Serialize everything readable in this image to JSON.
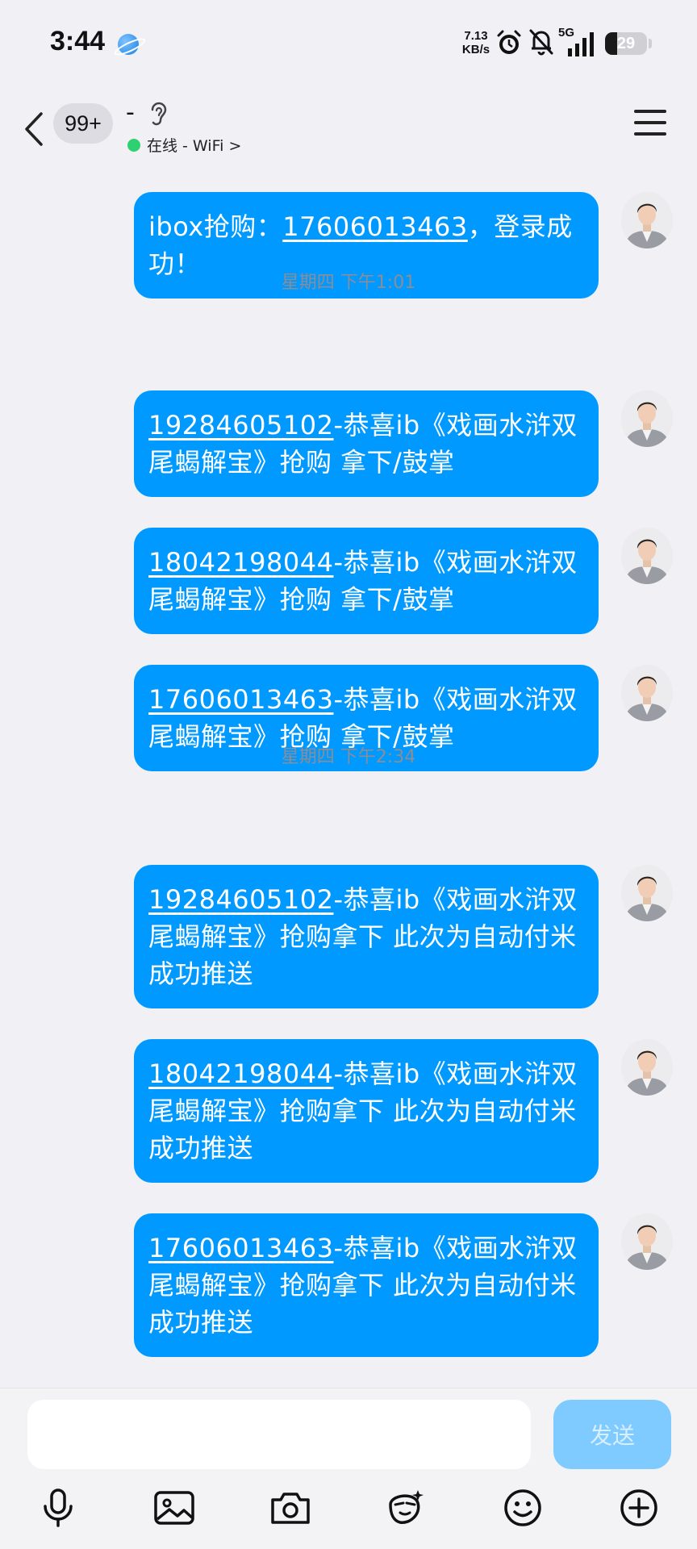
{
  "status_bar": {
    "time": "3:44",
    "net_speed_value": "7.13",
    "net_speed_unit": "KB/s",
    "network": "5G",
    "battery": "29",
    "battery_level": 0.29
  },
  "header": {
    "unread_count": "99+",
    "contact_name": "-",
    "status_text": "在线 - WiFi >",
    "status_color": "#2fd06f"
  },
  "messages": [
    {
      "type": "message",
      "phone": "",
      "text_before": "ibox抢购：",
      "phone_inline": "17606013463",
      "text": "，登录成功！"
    },
    {
      "type": "time",
      "text": "星期四 下午1:01"
    },
    {
      "type": "message",
      "phone": "19284605102",
      "text": "-恭喜ib《戏画水浒双尾蝎解宝》抢购 拿下/鼓掌"
    },
    {
      "type": "message",
      "phone": "18042198044",
      "text": "-恭喜ib《戏画水浒双尾蝎解宝》抢购 拿下/鼓掌"
    },
    {
      "type": "message",
      "phone": "17606013463",
      "text": "-恭喜ib《戏画水浒双尾蝎解宝》抢购 拿下/鼓掌"
    },
    {
      "type": "time",
      "text": "星期四 下午2:34"
    },
    {
      "type": "message",
      "phone": "19284605102",
      "text": "-恭喜ib《戏画水浒双尾蝎解宝》抢购拿下 此次为自动付米成功推送"
    },
    {
      "type": "message",
      "phone": "18042198044",
      "text": "-恭喜ib《戏画水浒双尾蝎解宝》抢购拿下 此次为自动付米成功推送"
    },
    {
      "type": "message",
      "phone": "17606013463",
      "text": "-恭喜ib《戏画水浒双尾蝎解宝》抢购拿下 此次为自动付米成功推送"
    }
  ],
  "input": {
    "placeholder": "",
    "value": "",
    "send_label": "发送"
  },
  "toolbar": {
    "icons": [
      "microphone-icon",
      "image-icon",
      "camera-icon",
      "emoji-sticker-icon",
      "smiley-icon",
      "plus-icon"
    ]
  },
  "colors": {
    "bubble": "#0099ff",
    "send_button": "#7fcbff",
    "background": "#f1f1f5"
  }
}
